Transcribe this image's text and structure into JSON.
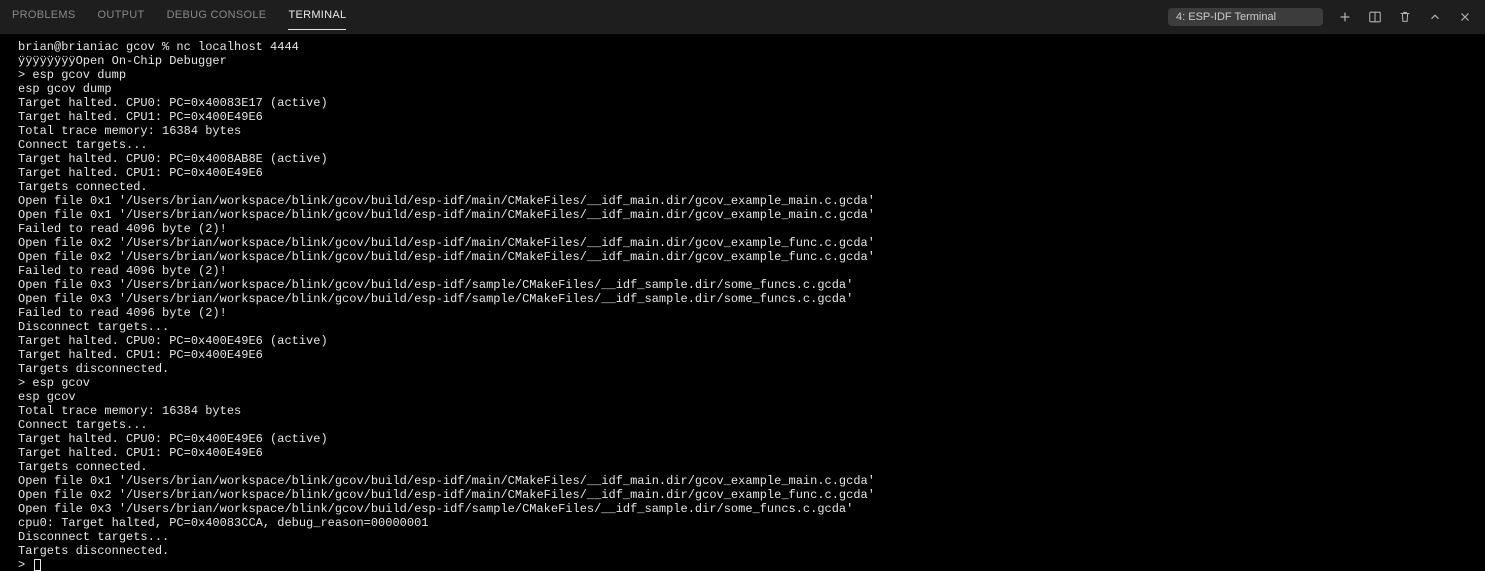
{
  "tabs": {
    "problems": "PROBLEMS",
    "output": "OUTPUT",
    "debug_console": "DEBUG CONSOLE",
    "terminal": "TERMINAL"
  },
  "terminal_selector": {
    "label": "4: ESP-IDF Terminal"
  },
  "terminal": {
    "lines": [
      "brian@brianiac gcov % nc localhost 4444",
      "ÿÿÿÿÿÿÿÿOpen On-Chip Debugger",
      "> esp gcov dump",
      "esp gcov dump",
      "Target halted. CPU0: PC=0x40083E17 (active)",
      "Target halted. CPU1: PC=0x400E49E6",
      "Total trace memory: 16384 bytes",
      "Connect targets...",
      "Target halted. CPU0: PC=0x4008AB8E (active)",
      "Target halted. CPU1: PC=0x400E49E6",
      "Targets connected.",
      "Open file 0x1 '/Users/brian/workspace/blink/gcov/build/esp-idf/main/CMakeFiles/__idf_main.dir/gcov_example_main.c.gcda'",
      "Open file 0x1 '/Users/brian/workspace/blink/gcov/build/esp-idf/main/CMakeFiles/__idf_main.dir/gcov_example_main.c.gcda'",
      "Failed to read 4096 byte (2)!",
      "Open file 0x2 '/Users/brian/workspace/blink/gcov/build/esp-idf/main/CMakeFiles/__idf_main.dir/gcov_example_func.c.gcda'",
      "Open file 0x2 '/Users/brian/workspace/blink/gcov/build/esp-idf/main/CMakeFiles/__idf_main.dir/gcov_example_func.c.gcda'",
      "Failed to read 4096 byte (2)!",
      "Open file 0x3 '/Users/brian/workspace/blink/gcov/build/esp-idf/sample/CMakeFiles/__idf_sample.dir/some_funcs.c.gcda'",
      "Open file 0x3 '/Users/brian/workspace/blink/gcov/build/esp-idf/sample/CMakeFiles/__idf_sample.dir/some_funcs.c.gcda'",
      "Failed to read 4096 byte (2)!",
      "Disconnect targets...",
      "Target halted. CPU0: PC=0x400E49E6 (active)",
      "Target halted. CPU1: PC=0x400E49E6",
      "Targets disconnected.",
      "> esp gcov",
      "esp gcov",
      "Total trace memory: 16384 bytes",
      "Connect targets...",
      "Target halted. CPU0: PC=0x400E49E6 (active)",
      "Target halted. CPU1: PC=0x400E49E6",
      "Targets connected.",
      "Open file 0x1 '/Users/brian/workspace/blink/gcov/build/esp-idf/main/CMakeFiles/__idf_main.dir/gcov_example_main.c.gcda'",
      "Open file 0x2 '/Users/brian/workspace/blink/gcov/build/esp-idf/main/CMakeFiles/__idf_main.dir/gcov_example_func.c.gcda'",
      "Open file 0x3 '/Users/brian/workspace/blink/gcov/build/esp-idf/sample/CMakeFiles/__idf_sample.dir/some_funcs.c.gcda'",
      "cpu0: Target halted, PC=0x40083CCA, debug_reason=00000001",
      "Disconnect targets...",
      "Targets disconnected."
    ],
    "prompt": "> "
  }
}
